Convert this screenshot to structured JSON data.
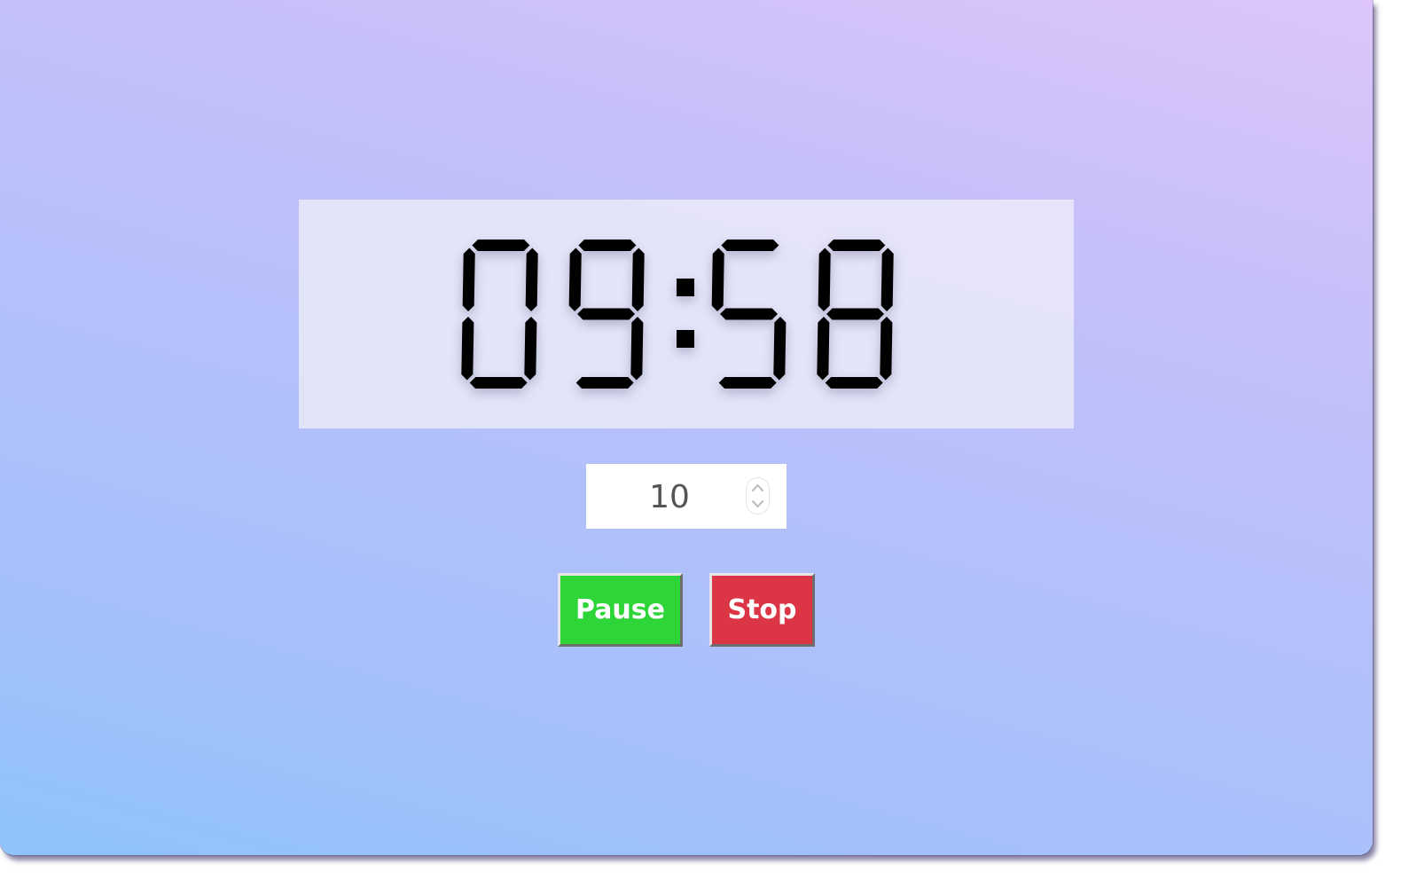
{
  "timer": {
    "display": "09:58",
    "digits": [
      "0",
      "9",
      "5",
      "8"
    ],
    "digit_color": "#000000"
  },
  "minutes_input": {
    "value": "10"
  },
  "controls": {
    "pause_label": "Pause",
    "stop_label": "Stop",
    "pause_color": "#2dd539",
    "stop_color": "#dc3545"
  },
  "icons": {
    "stepper_up": "chevron-up-icon",
    "stepper_down": "chevron-down-icon"
  }
}
